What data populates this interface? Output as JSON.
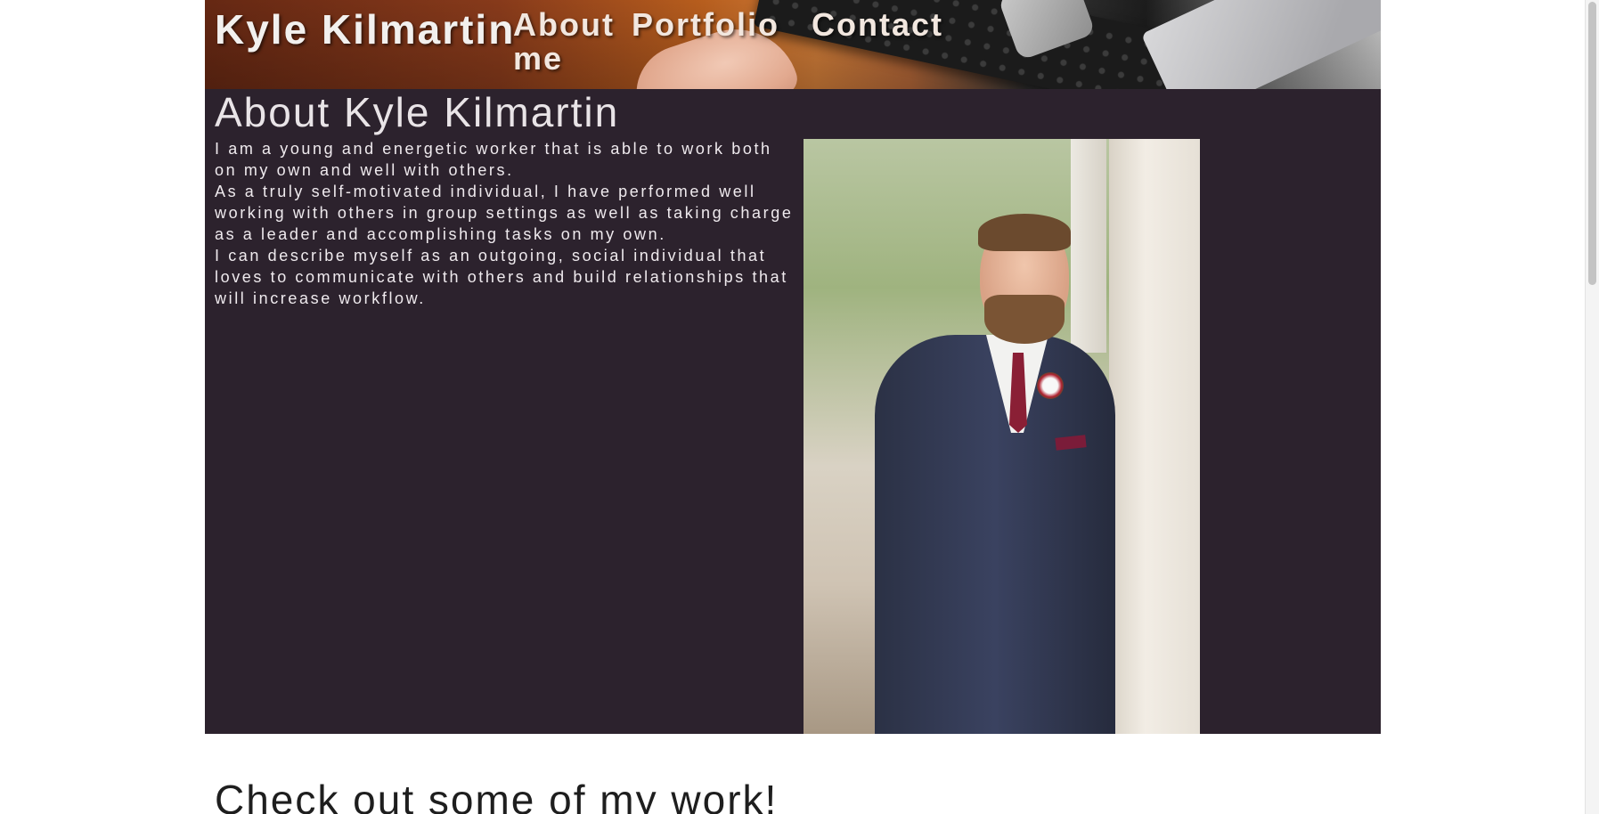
{
  "header": {
    "site_title": "Kyle Kilmartin",
    "nav": {
      "about": "About me",
      "portfolio": "Portfolio",
      "contact": "Contact"
    }
  },
  "about": {
    "heading": "About Kyle Kilmartin",
    "paragraphs": [
      "I am a young and energetic worker that is able to work both on my own and well with others.",
      "As a truly self-motivated individual, I have performed well working with others in group settings as well as taking charge as a leader and accomplishing tasks on my own.",
      "I can describe myself as an outgoing, social individual that loves to communicate with others and build relationships that will increase workflow."
    ],
    "portrait_alt": "Portrait of Kyle Kilmartin in a navy suit"
  },
  "work": {
    "heading": "Check out some of my work!"
  },
  "colors": {
    "about_background": "#2c222d",
    "page_background": "#ffffff",
    "header_text": "#f2f0ee"
  }
}
